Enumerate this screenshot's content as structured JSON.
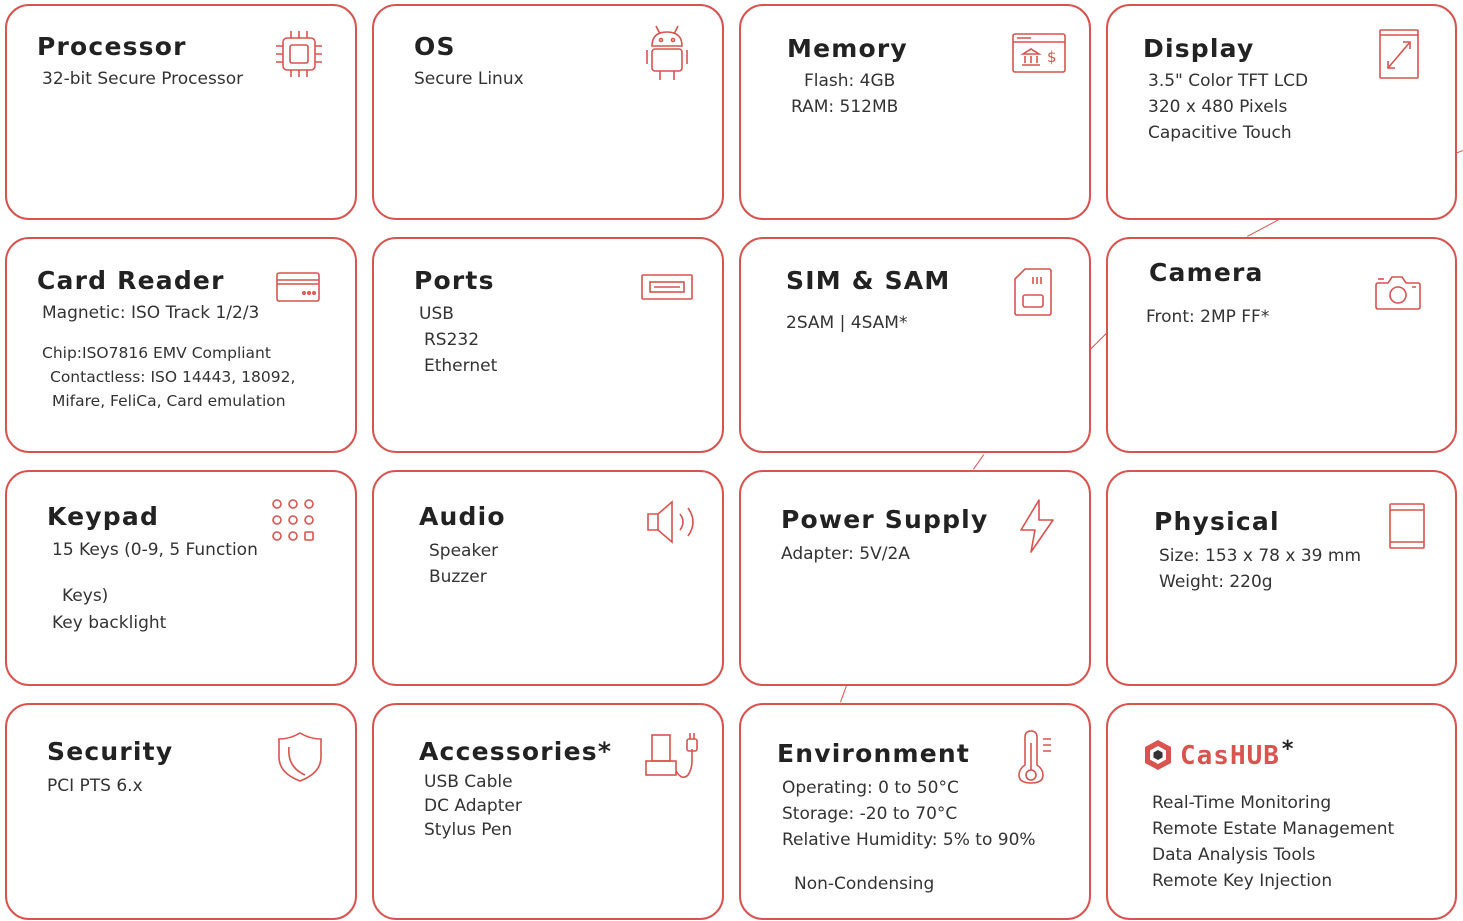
{
  "accent_color": "#d9534f",
  "cards": {
    "processor": {
      "title": "Processor",
      "lines": [
        "32-bit Secure Processor"
      ],
      "icon": "cpu-chip-icon"
    },
    "os": {
      "title": "OS",
      "lines": [
        "Secure Linux"
      ],
      "icon": "android-icon"
    },
    "memory": {
      "title": "Memory",
      "lines": [
        "Flash:   4GB",
        "RAM: 512MB"
      ],
      "icon": "bank-window-icon"
    },
    "display": {
      "title": "Display",
      "lines": [
        "3.5\" Color TFT LCD",
        "320 x 480 Pixels",
        "Capacitive Touch"
      ],
      "icon": "screen-expand-icon"
    },
    "card_reader": {
      "title": "Card Reader",
      "lines": [
        "Magnetic: ISO Track 1/2/3",
        "Chip:ISO7816 EMV Compliant",
        "Contactless: ISO 14443, 18092,",
        "Mifare, FeliCa, Card emulation"
      ],
      "icon": "card-reader-icon"
    },
    "ports": {
      "title": "Ports",
      "lines": [
        "USB",
        "RS232",
        "Ethernet"
      ],
      "icon": "usb-port-icon"
    },
    "sim_sam": {
      "title": "SIM & SAM",
      "lines": [
        "2SAM | 4SAM*"
      ],
      "icon": "sim-card-icon"
    },
    "camera": {
      "title": "Camera",
      "lines": [
        "Front: 2MP FF*"
      ],
      "icon": "camera-icon"
    },
    "keypad": {
      "title": "Keypad",
      "lines": [
        "15 Keys (0-9, 5 Function",
        "Keys)",
        "Key backlight"
      ],
      "icon": "keypad-grid-icon"
    },
    "audio": {
      "title": "Audio",
      "lines": [
        "Speaker",
        "Buzzer"
      ],
      "icon": "speaker-icon"
    },
    "power_supply": {
      "title": "Power Supply",
      "lines": [
        "Adapter: 5V/2A"
      ],
      "icon": "lightning-bolt-icon"
    },
    "physical": {
      "title": "Physical",
      "lines": [
        "Size: 153 x 78 x 39 mm",
        "Weight: 220g"
      ],
      "icon": "device-outline-icon"
    },
    "security": {
      "title": "Security",
      "lines": [
        "PCI PTS 6.x"
      ],
      "icon": "shield-icon"
    },
    "accessories": {
      "title": "Accessories*",
      "lines": [
        "USB Cable",
        "DC Adapter",
        "Stylus Pen"
      ],
      "icon": "charging-cable-icon"
    },
    "environment": {
      "title": "Environment",
      "lines": [
        "Operating: 0 to 50°C",
        "Storage: -20 to 70°C",
        "Relative Humidity: 5% to 90%",
        "Non-Condensing"
      ],
      "icon": "thermometer-icon"
    },
    "cashub": {
      "brand": "CasHUB",
      "mark": "*",
      "lines": [
        "Real-Time Monitoring",
        "Remote Estate Management",
        "Data Analysis Tools",
        "Remote Key Injection"
      ],
      "icon": "cashub-logo-icon"
    }
  }
}
